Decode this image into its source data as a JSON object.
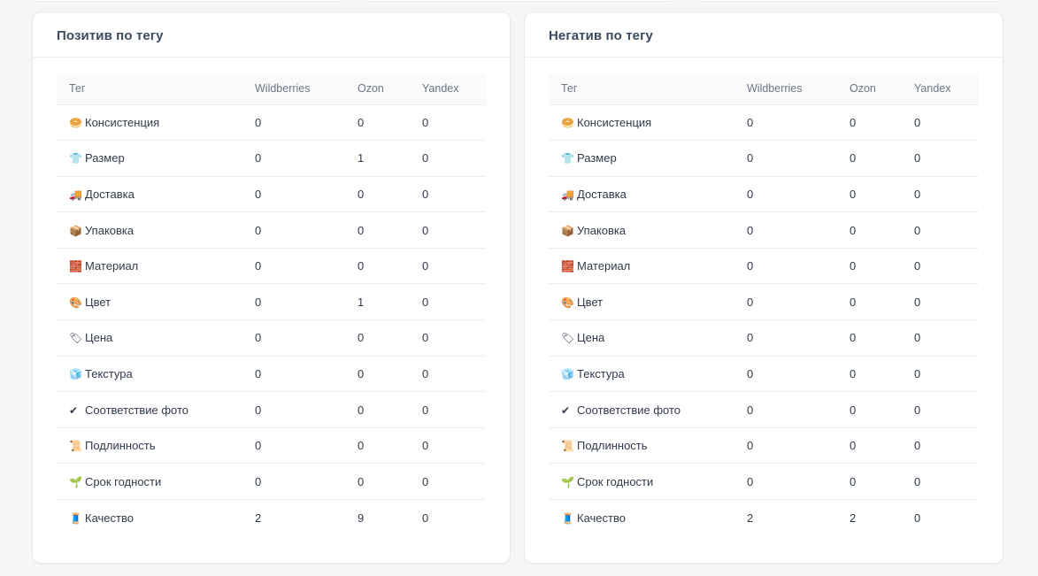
{
  "positive": {
    "title": "Позитив по тегу",
    "columns": [
      "Тег",
      "Wildberries",
      "Ozon",
      "Yandex"
    ],
    "rows": [
      {
        "icon": "🥯",
        "tag": "Консистенция",
        "wb": "0",
        "ozon": "0",
        "yandex": "0"
      },
      {
        "icon": "👕",
        "tag": "Размер",
        "wb": "0",
        "ozon": "1",
        "yandex": "0"
      },
      {
        "icon": "🚚",
        "tag": "Доставка",
        "wb": "0",
        "ozon": "0",
        "yandex": "0"
      },
      {
        "icon": "📦",
        "tag": "Упаковка",
        "wb": "0",
        "ozon": "0",
        "yandex": "0"
      },
      {
        "icon": "🧱",
        "tag": "Материал",
        "wb": "0",
        "ozon": "0",
        "yandex": "0"
      },
      {
        "icon": "🎨",
        "tag": "Цвет",
        "wb": "0",
        "ozon": "1",
        "yandex": "0"
      },
      {
        "icon": "🏷",
        "tag": "Цена",
        "wb": "0",
        "ozon": "0",
        "yandex": "0"
      },
      {
        "icon": "🧊",
        "tag": "Текстура",
        "wb": "0",
        "ozon": "0",
        "yandex": "0"
      },
      {
        "icon": "✔",
        "tag": "Соответствие фото",
        "wb": "0",
        "ozon": "0",
        "yandex": "0"
      },
      {
        "icon": "📜",
        "tag": "Подлинность",
        "wb": "0",
        "ozon": "0",
        "yandex": "0"
      },
      {
        "icon": "🌱",
        "tag": "Срок годности",
        "wb": "0",
        "ozon": "0",
        "yandex": "0"
      },
      {
        "icon": "🧵",
        "tag": "Качество",
        "wb": "2",
        "ozon": "9",
        "yandex": "0"
      }
    ]
  },
  "negative": {
    "title": "Негатив по тегу",
    "columns": [
      "Тег",
      "Wildberries",
      "Ozon",
      "Yandex"
    ],
    "rows": [
      {
        "icon": "🥯",
        "tag": "Консистенция",
        "wb": "0",
        "ozon": "0",
        "yandex": "0"
      },
      {
        "icon": "👕",
        "tag": "Размер",
        "wb": "0",
        "ozon": "0",
        "yandex": "0"
      },
      {
        "icon": "🚚",
        "tag": "Доставка",
        "wb": "0",
        "ozon": "0",
        "yandex": "0"
      },
      {
        "icon": "📦",
        "tag": "Упаковка",
        "wb": "0",
        "ozon": "0",
        "yandex": "0"
      },
      {
        "icon": "🧱",
        "tag": "Материал",
        "wb": "0",
        "ozon": "0",
        "yandex": "0"
      },
      {
        "icon": "🎨",
        "tag": "Цвет",
        "wb": "0",
        "ozon": "0",
        "yandex": "0"
      },
      {
        "icon": "🏷",
        "tag": "Цена",
        "wb": "0",
        "ozon": "0",
        "yandex": "0"
      },
      {
        "icon": "🧊",
        "tag": "Текстура",
        "wb": "0",
        "ozon": "0",
        "yandex": "0"
      },
      {
        "icon": "✔",
        "tag": "Соответствие фото",
        "wb": "0",
        "ozon": "0",
        "yandex": "0"
      },
      {
        "icon": "📜",
        "tag": "Подлинность",
        "wb": "0",
        "ozon": "0",
        "yandex": "0"
      },
      {
        "icon": "🌱",
        "tag": "Срок годности",
        "wb": "0",
        "ozon": "0",
        "yandex": "0"
      },
      {
        "icon": "🧵",
        "tag": "Качество",
        "wb": "2",
        "ozon": "2",
        "yandex": "0"
      }
    ]
  }
}
